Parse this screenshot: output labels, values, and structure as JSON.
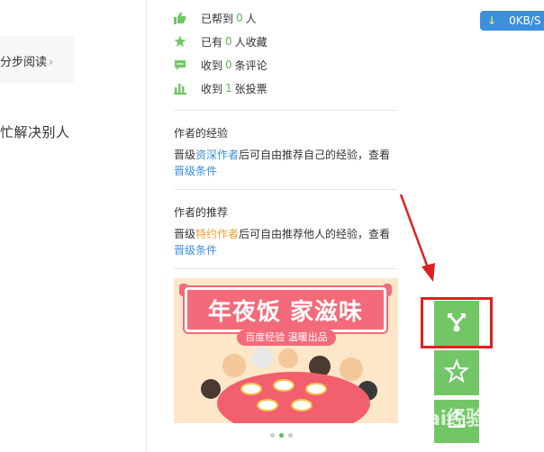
{
  "sidebar": {
    "link_label": "分步阅读",
    "link_chevron": "›",
    "fragment_text": "忙解决别人"
  },
  "stats": [
    {
      "icon": "thumbs-up-icon",
      "prefix": "已帮到",
      "value": "0",
      "suffix": "人"
    },
    {
      "icon": "star-icon",
      "prefix": "已有",
      "value": "0",
      "suffix": "人收藏"
    },
    {
      "icon": "comment-icon",
      "prefix": "收到",
      "value": "0",
      "suffix": "条评论"
    },
    {
      "icon": "bar-chart-icon",
      "prefix": "收到",
      "value": "1",
      "suffix": "张投票"
    }
  ],
  "author_experience": {
    "title": "作者的经验",
    "text_before": "晋级",
    "highlight": "资深作者",
    "text_after": "后可自由推荐自己的经验，查看",
    "link": "晋级条件"
  },
  "author_recommend": {
    "title": "作者的推荐",
    "text_before": "晋级",
    "highlight": "特约作者",
    "text_after": "后可自由推荐他人的经验，查看",
    "link": "晋级条件"
  },
  "banner": {
    "title": "年夜饭 家滋味",
    "subtitle": "百度经验 温暖出品",
    "dots": 3,
    "active_dot": 1
  },
  "speed_widget": {
    "arrow": "↓",
    "text": "0KB/S"
  },
  "side_buttons": [
    {
      "icon": "share-icon"
    },
    {
      "icon": "star-outline-icon"
    },
    {
      "icon": "upload-icon"
    }
  ],
  "watermark": "Bai经验",
  "colors": {
    "accent_green": "#72c666",
    "link_blue": "#3b8fd6",
    "highlight_orange": "#f0a030",
    "annotation_red": "#e02020",
    "banner_red": "#f36a7a"
  }
}
